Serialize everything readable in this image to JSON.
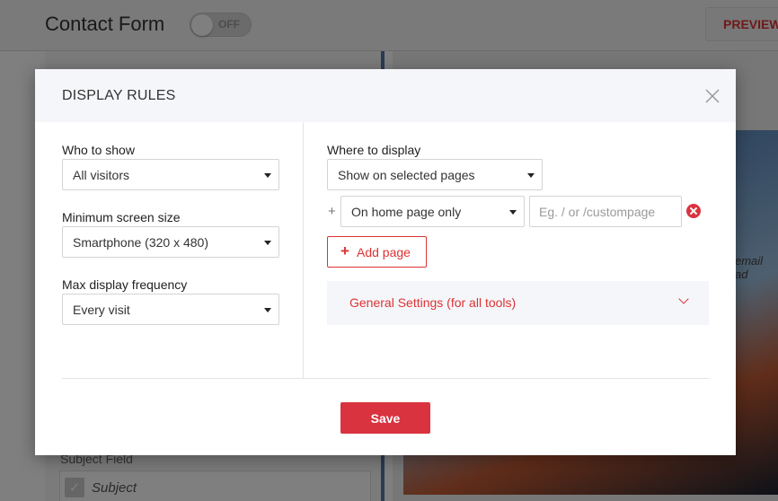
{
  "background": {
    "title": "Contact Form",
    "toggle_label": "OFF",
    "preview_label": "PREVIEW",
    "subject_field_label": "Subject Field",
    "subject_value": "Subject",
    "email_hint": "email ad"
  },
  "modal": {
    "title": "DISPLAY RULES",
    "left": {
      "who_to_show": {
        "label": "Who to show",
        "value": "All visitors"
      },
      "min_screen_size": {
        "label": "Minimum screen size",
        "value": "Smartphone (320 x 480)"
      },
      "max_display_frequency": {
        "label": "Max display frequency",
        "value": "Every visit"
      }
    },
    "right": {
      "where_to_display": {
        "label": "Where to display",
        "value": "Show on selected pages"
      },
      "page_rule": {
        "plus": "+",
        "value": "On home page only",
        "input_placeholder": "Eg. / or /custompage",
        "input_value": ""
      },
      "add_page_label": "Add page",
      "add_page_icon": "+",
      "general_settings_label": "General Settings (for all tools)"
    },
    "save_label": "Save"
  },
  "colors": {
    "accent": "#d9333f",
    "header_bg": "#f5f6fa"
  }
}
